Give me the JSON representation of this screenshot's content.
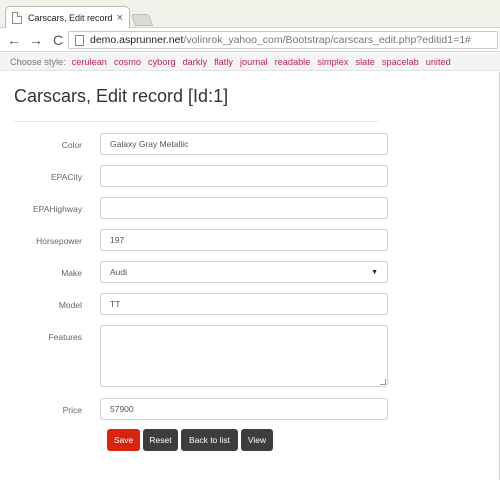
{
  "browser": {
    "tab_title": "Carscars, Edit record [Id:1]",
    "tab_close": "×",
    "back_glyph": "←",
    "forward_glyph": "→",
    "reload_glyph": "C",
    "url_domain": "demo.asprunner.net",
    "url_path": "/volinrok_yahoo_com/Bootstrap/carscars_edit.php?editid1=1#"
  },
  "style_switcher": {
    "label": "Choose style:",
    "styles": [
      "cerulean",
      "cosmo",
      "cyborg",
      "darkly",
      "flatly",
      "journal",
      "readable",
      "simplex",
      "slate",
      "spacelab",
      "united"
    ]
  },
  "page": {
    "title": "Carscars, Edit record [Id:1]"
  },
  "form": {
    "color": {
      "label": "Color",
      "value": "Galaxy Gray Metallic"
    },
    "epa_city": {
      "label": "EPACity",
      "value": ""
    },
    "epa_highway": {
      "label": "EPAHighway",
      "value": ""
    },
    "horsepower": {
      "label": "Horsepower",
      "value": "197"
    },
    "make": {
      "label": "Make",
      "value": "Audi"
    },
    "model": {
      "label": "Model",
      "value": "TT"
    },
    "features": {
      "label": "Features",
      "value": ""
    },
    "price": {
      "label": "Price",
      "value": "57900"
    }
  },
  "buttons": {
    "save": "Save",
    "reset": "Reset",
    "back_to_list": "Back to list",
    "view": "View"
  },
  "colors": {
    "accent": "#d9230f",
    "dark_button": "#3d3d3d",
    "link": "#c7254e"
  }
}
